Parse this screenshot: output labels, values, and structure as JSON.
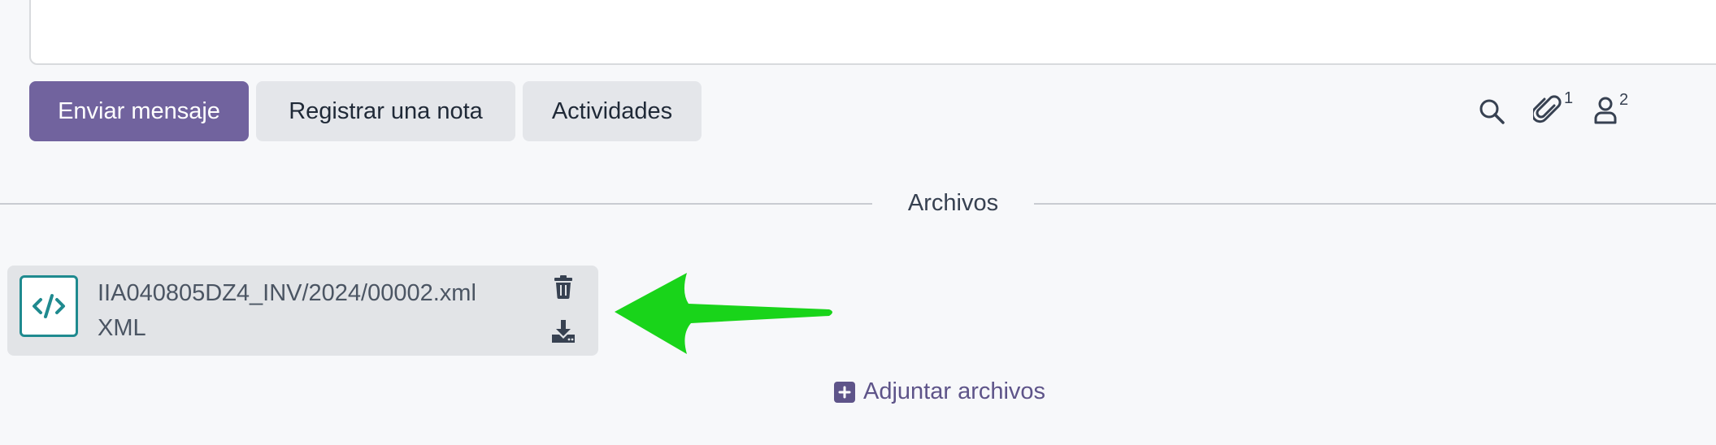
{
  "composer": {
    "send_message_label": "Enviar mensaje",
    "log_note_label": "Registrar una nota",
    "activities_label": "Actividades",
    "attachments_count": "1",
    "followers_count": "2"
  },
  "files_section": {
    "title": "Archivos",
    "attachments": [
      {
        "name": "IIA040805DZ4_INV/2024/00002.xml",
        "type": "XML",
        "icon": "code-file-icon"
      }
    ],
    "add_files_label": "Adjuntar archivos"
  },
  "colors": {
    "primary": "#71639e",
    "annotation_arrow": "#19d41a",
    "file_icon_teal": "#1f8a8f"
  }
}
